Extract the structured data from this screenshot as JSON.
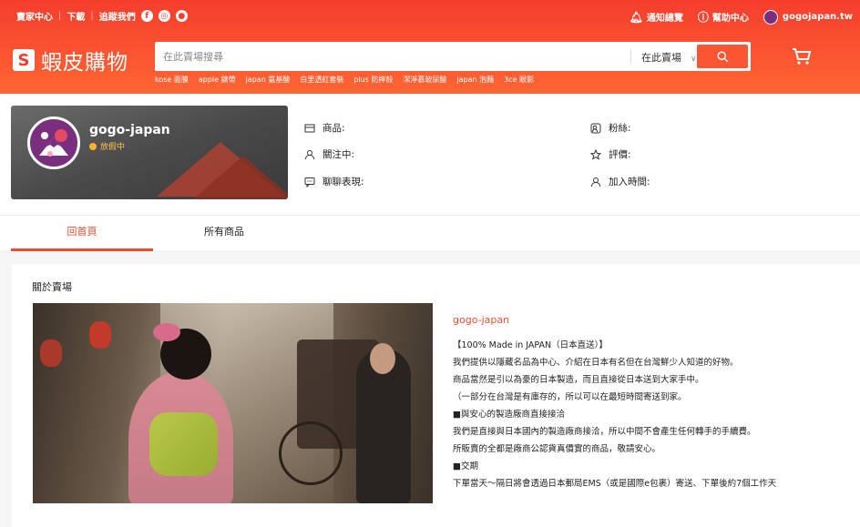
{
  "topbar": {
    "links": [
      "賣家中心",
      "下載",
      "追蹤我們"
    ],
    "social_icons": [
      "facebook-icon",
      "instagram-icon",
      "line-icon"
    ],
    "notifications": "通知總覽",
    "help": "幫助中心",
    "username": "gogojapan.tw"
  },
  "logo": {
    "text": "蝦皮購物"
  },
  "search": {
    "placeholder": "在此賣場搜尋",
    "scope": "在此賣場"
  },
  "hints": [
    "kose 面膜",
    "apple 錶帶",
    "japan 氨基酸",
    "白里透紅套裝",
    "plus 防摔殼",
    "潔淨慕玻尿酸",
    "japan 泡麵",
    "3ce 眼影"
  ],
  "shop": {
    "name": "gogo-japan",
    "status": "放假中"
  },
  "stats": {
    "products": "商品:",
    "following": "關注中:",
    "chat": "聊聊表現:",
    "followers": "粉絲:",
    "rating": "評價:",
    "joined": "加入時間:"
  },
  "tabs": [
    "回首頁",
    "所有商品"
  ],
  "about": {
    "title": "關於賣場",
    "shop_name": "gogo-japan",
    "lines": [
      "【100% Made in JAPAN（日本直送）】",
      "我們提供以隱藏名品為中心、介紹在日本有名但在台灣鮮少人知道的好物。",
      "商品當然是引以為豪的日本製造，而且直接從日本送到大家手中。",
      "（一部分在台灣是有庫存的，所以可以在最短時間寄送到家。",
      "■與安心的製造廠商直接接洽",
      "我們是直接與日本國內的製造廠商接洽，所以中間不會產生任何轉手的手續費。",
      "所販賣的全都是廠商公認貨真價實的商品，敬請安心。",
      "■交期",
      "下單當天〜隔日將會透過日本郵局EMS（或是國際e包裹）寄送、下單後約7個工作天"
    ]
  },
  "colors": {
    "brand": "#ee4d2d",
    "header": "#f53d2d"
  }
}
